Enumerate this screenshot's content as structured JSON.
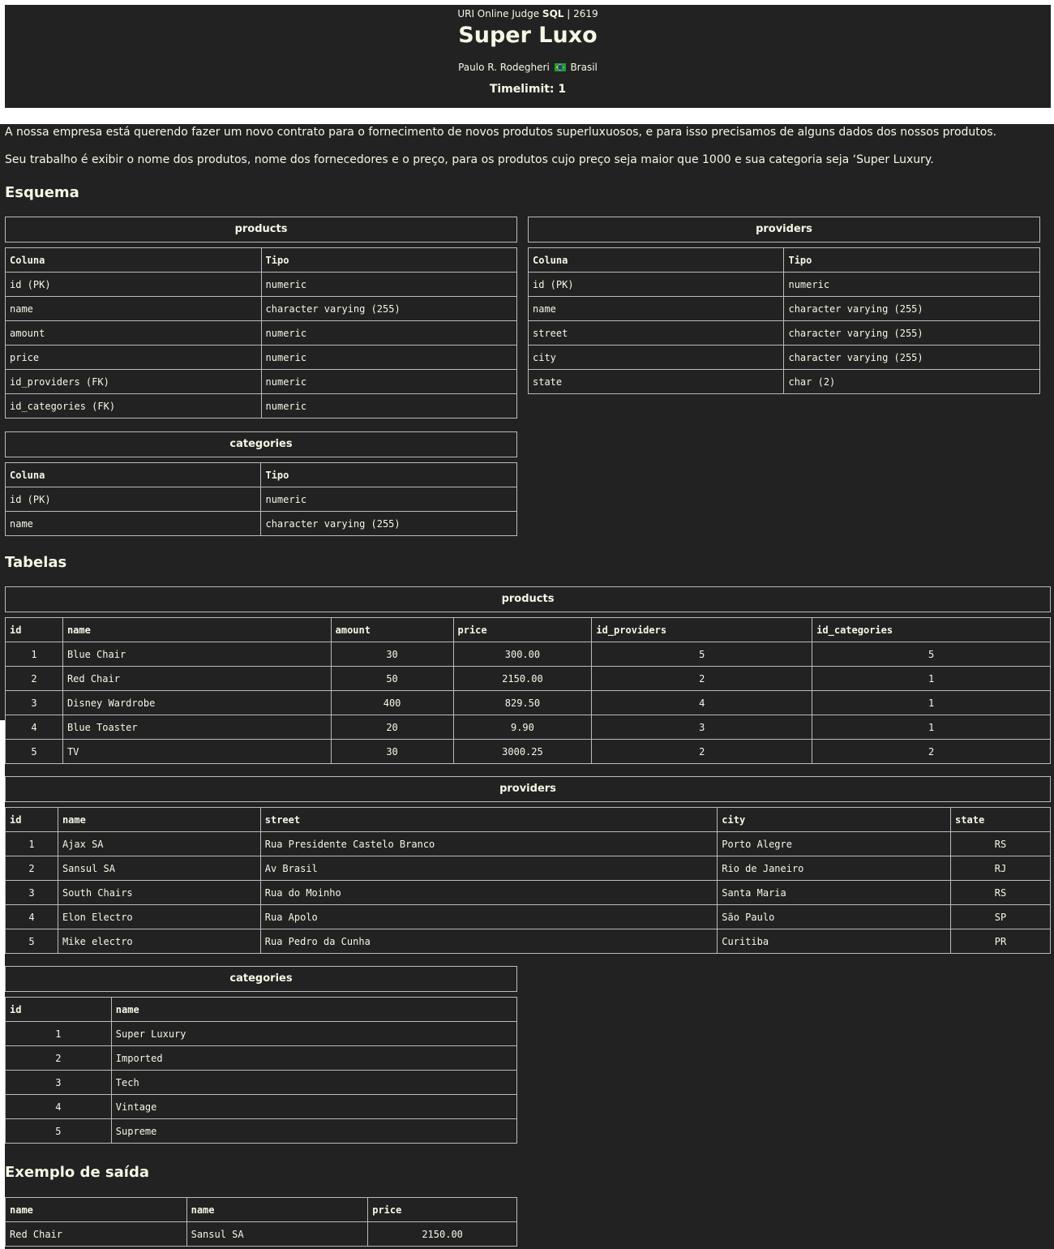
{
  "header": {
    "judge_prefix": "URI Online Judge",
    "judge_category": "SQL",
    "judge_suffix": "| 2619",
    "title": "Super Luxo",
    "author": "Paulo R. Rodegheri",
    "country": "Brasil",
    "timelimit": "Timelimit: 1"
  },
  "description": {
    "p1": "A nossa empresa está querendo fazer um novo contrato para o fornecimento de novos produtos superluxuosos, e para isso precisamos de alguns dados dos nossos produtos.",
    "p2": "Seu trabalho é exibir o nome dos produtos, nome dos fornecedores e o preço, para os produtos cujo preço seja maior que 1000 e sua categoria seja ‘Super Luxury."
  },
  "schema": {
    "heading": "Esquema",
    "col_header": "Coluna",
    "type_header": "Tipo",
    "products": {
      "caption": "products",
      "rows": [
        [
          "id (PK)",
          "numeric"
        ],
        [
          "name",
          "character varying (255)"
        ],
        [
          "amount",
          "numeric"
        ],
        [
          "price",
          "numeric"
        ],
        [
          "id_providers (FK)",
          "numeric"
        ],
        [
          "id_categories (FK)",
          "numeric"
        ]
      ]
    },
    "providers": {
      "caption": "providers",
      "rows": [
        [
          "id (PK)",
          "numeric"
        ],
        [
          "name",
          "character varying (255)"
        ],
        [
          "street",
          "character varying (255)"
        ],
        [
          "city",
          "character varying (255)"
        ],
        [
          "state",
          "char (2)"
        ]
      ]
    },
    "categories": {
      "caption": "categories",
      "rows": [
        [
          "id (PK)",
          "numeric"
        ],
        [
          "name",
          "character varying (255)"
        ]
      ]
    }
  },
  "tables": {
    "heading": "Tabelas",
    "products": {
      "caption": "products",
      "headers": [
        "id",
        "name",
        "amount",
        "price",
        "id_providers",
        "id_categories"
      ],
      "rows": [
        [
          "1",
          "Blue Chair",
          "30",
          "300.00",
          "5",
          "5"
        ],
        [
          "2",
          "Red Chair",
          "50",
          "2150.00",
          "2",
          "1"
        ],
        [
          "3",
          "Disney Wardrobe",
          "400",
          "829.50",
          "4",
          "1"
        ],
        [
          "4",
          "Blue Toaster",
          "20",
          "9.90",
          "3",
          "1"
        ],
        [
          "5",
          "TV",
          "30",
          "3000.25",
          "2",
          "2"
        ]
      ]
    },
    "providers": {
      "caption": "providers",
      "headers": [
        "id",
        "name",
        "street",
        "city",
        "state"
      ],
      "rows": [
        [
          "1",
          "Ajax SA",
          "Rua Presidente Castelo Branco",
          "Porto Alegre",
          "RS"
        ],
        [
          "2",
          "Sansul SA",
          "Av Brasil",
          "Rio de Janeiro",
          "RJ"
        ],
        [
          "3",
          "South Chairs",
          "Rua do Moinho",
          "Santa Maria",
          "RS"
        ],
        [
          "4",
          "Elon Electro",
          "Rua Apolo",
          "São Paulo",
          "SP"
        ],
        [
          "5",
          "Mike electro",
          "Rua Pedro da Cunha",
          "Curitiba",
          "PR"
        ]
      ]
    },
    "categories": {
      "caption": "categories",
      "headers": [
        "id",
        "name"
      ],
      "rows": [
        [
          "1",
          "Super Luxury"
        ],
        [
          "2",
          "Imported"
        ],
        [
          "3",
          "Tech"
        ],
        [
          "4",
          "Vintage"
        ],
        [
          "5",
          "Supreme"
        ]
      ]
    }
  },
  "output": {
    "heading": "Exemplo de saída",
    "headers": [
      "name",
      "name",
      "price"
    ],
    "rows": [
      [
        "Red Chair",
        "Sansul SA",
        "2150.00"
      ]
    ]
  }
}
